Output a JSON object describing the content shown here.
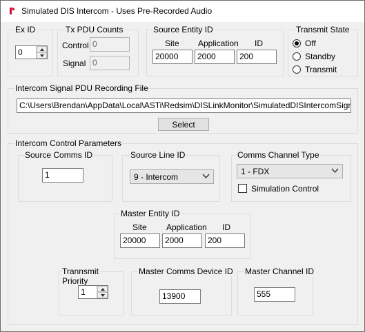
{
  "window": {
    "title": "Simulated DIS Intercom - Uses Pre-Recorded Audio"
  },
  "ex_id": {
    "title": "Ex ID",
    "value": "0"
  },
  "tx_pdu": {
    "title": "Tx PDU Counts",
    "control_label": "Control",
    "control_value": "0",
    "signal_label": "Signal",
    "signal_value": "0"
  },
  "source_entity": {
    "title": "Source Entity ID",
    "site_label": "Site",
    "site_value": "20000",
    "app_label": "Application",
    "app_value": "2000",
    "id_label": "ID",
    "id_value": "200"
  },
  "transmit_state": {
    "title": "Transmit State",
    "options": [
      "Off",
      "Standby",
      "Transmit"
    ],
    "selected": "Off"
  },
  "recording": {
    "title": "Intercom Signal PDU Recording File",
    "path": "C:\\Users\\Brendan\\AppData\\Local\\ASTi\\Redsim\\DISLinkMonitor\\SimulatedDISIntercomSignalPDUs",
    "select_label": "Select"
  },
  "intercom": {
    "title": "Intercom Control Parameters",
    "source_comms": {
      "title": "Source Comms ID",
      "value": "1"
    },
    "source_line": {
      "title": "Source Line ID",
      "value": "9 - Intercom"
    },
    "comms_channel": {
      "title": "Comms Channel Type",
      "value": "1 - FDX",
      "sim_control_label": "Simulation Control"
    },
    "master_entity": {
      "title": "Master Entity ID",
      "site_label": "Site",
      "site_value": "20000",
      "app_label": "Application",
      "app_value": "2000",
      "id_label": "ID",
      "id_value": "200"
    },
    "priority": {
      "title_line1": "Trannsmit",
      "title_line2": "Priority",
      "value": "1"
    },
    "master_comms_device": {
      "title": "Master Comms Device ID",
      "value": "13900"
    },
    "master_channel": {
      "title": "Master Channel ID",
      "value": "555"
    }
  }
}
